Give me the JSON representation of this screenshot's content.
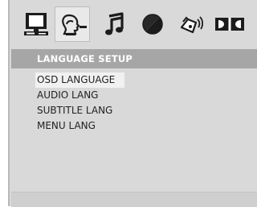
{
  "tabs": [
    {
      "icon": "monitor-icon",
      "selected": false
    },
    {
      "icon": "language-person-icon",
      "selected": true
    },
    {
      "icon": "music-note-icon",
      "selected": false
    },
    {
      "icon": "video-circle-icon",
      "selected": false
    },
    {
      "icon": "speaker-icon",
      "selected": false
    },
    {
      "icon": "dolby-icon",
      "selected": false
    }
  ],
  "header": {
    "title": "LANGUAGE SETUP"
  },
  "menu": {
    "items": [
      {
        "label": "OSD LANGUAGE",
        "selected": true
      },
      {
        "label": "AUDIO LANG",
        "selected": false
      },
      {
        "label": "SUBTITLE LANG",
        "selected": false
      },
      {
        "label": "MENU LANG",
        "selected": false
      }
    ]
  },
  "colors": {
    "panel": "#d9d9d9",
    "header_bg": "#a6a6a6",
    "header_text": "#ffffff",
    "selection_bg": "#f1f1f1"
  }
}
